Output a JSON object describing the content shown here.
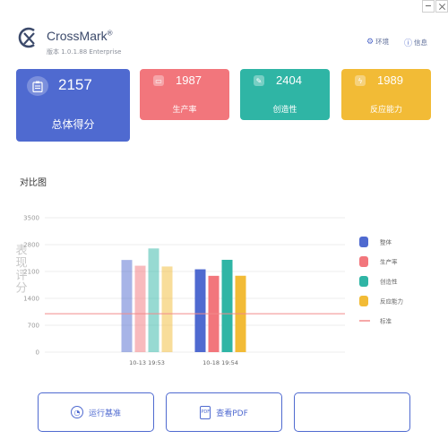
{
  "app": {
    "name": "CrossMark",
    "reg": "®",
    "version": "版本 1.0.1.88 Enterprise"
  },
  "header": {
    "env_label": "环境",
    "info_label": "信息"
  },
  "cards": {
    "total": {
      "score": "2157",
      "label": "总体得分",
      "color": "#4f6ad0"
    },
    "productivity": {
      "score": "1987",
      "label": "生产率",
      "color": "#f2767c"
    },
    "creativity": {
      "score": "2404",
      "label": "创造性",
      "color": "#2fb5a5"
    },
    "responsiveness": {
      "score": "1989",
      "label": "反应能力",
      "color": "#f2bb36"
    }
  },
  "section_title": "对比图",
  "chart_data": {
    "type": "bar",
    "title": "对比图",
    "ylabel": "表现评分",
    "ylim": [
      0,
      3500
    ],
    "yticks": [
      "0",
      "700",
      "1400",
      "2100",
      "2800",
      "3500"
    ],
    "categories": [
      "10-13 19:53",
      "10-18 19:54"
    ],
    "series": [
      {
        "name": "整体",
        "color": "#4f6ad0",
        "values": [
          2400,
          2157
        ]
      },
      {
        "name": "生产率",
        "color": "#f2767c",
        "values": [
          2250,
          1987
        ]
      },
      {
        "name": "创造性",
        "color": "#2fb5a5",
        "values": [
          2700,
          2404
        ]
      },
      {
        "name": "反应能力",
        "color": "#f2bb36",
        "values": [
          2230,
          1989
        ]
      }
    ],
    "baseline": {
      "name": "标准",
      "value": 1000,
      "color": "#f28a8a"
    },
    "legend_position": "right",
    "grid": true
  },
  "buttons": {
    "run_label": "运行基准",
    "pdf_label": "查看PDF",
    "pdf_icon_text": "PDF"
  },
  "colors": {
    "accent": "#4f6ad0"
  }
}
